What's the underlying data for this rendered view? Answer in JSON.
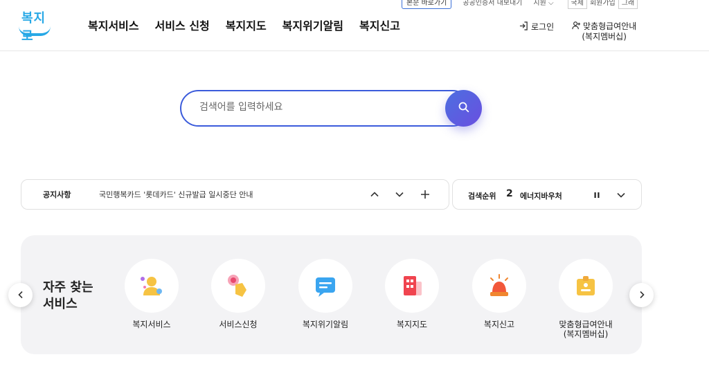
{
  "utility": {
    "shortcut_label": "본문 바로가기",
    "links": [
      "공공인증서 내보내기",
      "지원 ⌵"
    ],
    "boxes": [
      "국제",
      "회원가입",
      "그래"
    ]
  },
  "header": {
    "logo_text": "복지로",
    "nav": [
      "복지서비스",
      "서비스 신청",
      "복지지도",
      "복지위기알림",
      "복지신고"
    ],
    "login_label": "로그인",
    "member_line1": "맞춤형급여안내",
    "member_line2": "(복지멤버십)"
  },
  "search": {
    "placeholder": "검색어를 입력하세요"
  },
  "notice": {
    "title": "공지사항",
    "text": "국민행복카드 '롯데카드' 신규발급 일시중단 안내"
  },
  "rank": {
    "title": "검색순위",
    "number": "2",
    "keyword": "에너지바우처"
  },
  "quick": {
    "title_line1": "자주 찾는",
    "title_line2": "서비스",
    "items": [
      {
        "label": "복지서비스",
        "icon": "person-icon"
      },
      {
        "label": "서비스신청",
        "icon": "touch-hand-icon"
      },
      {
        "label": "복지위기알림",
        "icon": "message-icon"
      },
      {
        "label": "복지지도",
        "icon": "building-map-icon"
      },
      {
        "label": "복지신고",
        "icon": "siren-icon"
      },
      {
        "label": "맞춤형급여안내",
        "label2": "(복지멤버십)",
        "icon": "membership-card-icon"
      }
    ]
  },
  "colors": {
    "brand": "#27a8e6",
    "accent": "#3b5bdb",
    "panel_bg": "#f3f3f5"
  }
}
